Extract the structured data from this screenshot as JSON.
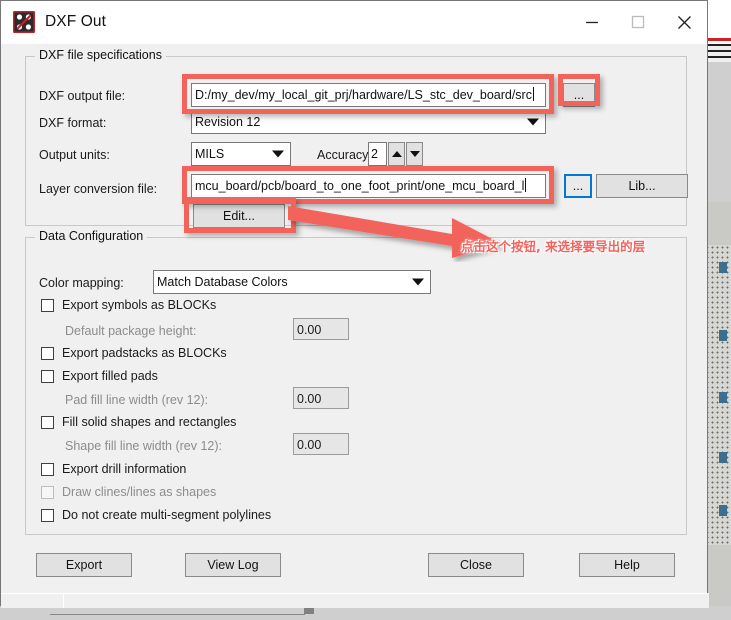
{
  "window": {
    "title": "DXF Out",
    "icon": "dxf-app-icon",
    "controls": {
      "minimize": "minimize-icon",
      "maximize": "maximize-icon",
      "close": "close-icon"
    }
  },
  "file_specs": {
    "legend": "DXF file specifications",
    "output_file": {
      "label": "DXF output file:",
      "value": "D:/my_dev/my_local_git_prj/hardware/LS_stc_dev_board/src",
      "browse_label": "..."
    },
    "format": {
      "label": "DXF format:",
      "value": "Revision 12"
    },
    "units": {
      "label": "Output units:",
      "value": "MILS"
    },
    "accuracy": {
      "label": "Accuracy:",
      "value": "2"
    },
    "layer_conversion": {
      "label": "Layer conversion file:",
      "value": "mcu_board/pcb/board_to_one_foot_print/one_mcu_board_l",
      "browse_label": "...",
      "lib_label": "Lib...",
      "edit_label": "Edit..."
    }
  },
  "data_config": {
    "legend": "Data Configuration",
    "color_mapping": {
      "label": "Color mapping:",
      "value": "Match Database Colors"
    },
    "options": [
      {
        "type": "checkbox",
        "label": "Export symbols as BLOCKs",
        "checked": false,
        "enabled": true
      },
      {
        "type": "field",
        "label": "Default package height:",
        "value": "0.00",
        "enabled": false
      },
      {
        "type": "checkbox",
        "label": "Export padstacks as BLOCKs",
        "checked": false,
        "enabled": true
      },
      {
        "type": "checkbox",
        "label": "Export filled pads",
        "checked": false,
        "enabled": true
      },
      {
        "type": "field",
        "label": "Pad fill line width (rev 12):",
        "value": "0.00",
        "enabled": false
      },
      {
        "type": "checkbox",
        "label": "Fill solid shapes and rectangles",
        "checked": false,
        "enabled": true
      },
      {
        "type": "field",
        "label": "Shape fill line width (rev 12):",
        "value": "0.00",
        "enabled": false
      },
      {
        "type": "checkbox",
        "label": "Export drill information",
        "checked": false,
        "enabled": true
      },
      {
        "type": "checkbox",
        "label": "Draw clines/lines as shapes",
        "checked": false,
        "enabled": false
      },
      {
        "type": "checkbox",
        "label": "Do not create multi-segment polylines",
        "checked": false,
        "enabled": true
      }
    ]
  },
  "footer": {
    "export_label": "Export",
    "view_log_label": "View Log",
    "close_label": "Close",
    "help_label": "Help"
  },
  "annotation": {
    "text": "点击这个按钮, 来选择要导出的层",
    "color": "#f2635c",
    "arrow": "annotation-arrow"
  }
}
